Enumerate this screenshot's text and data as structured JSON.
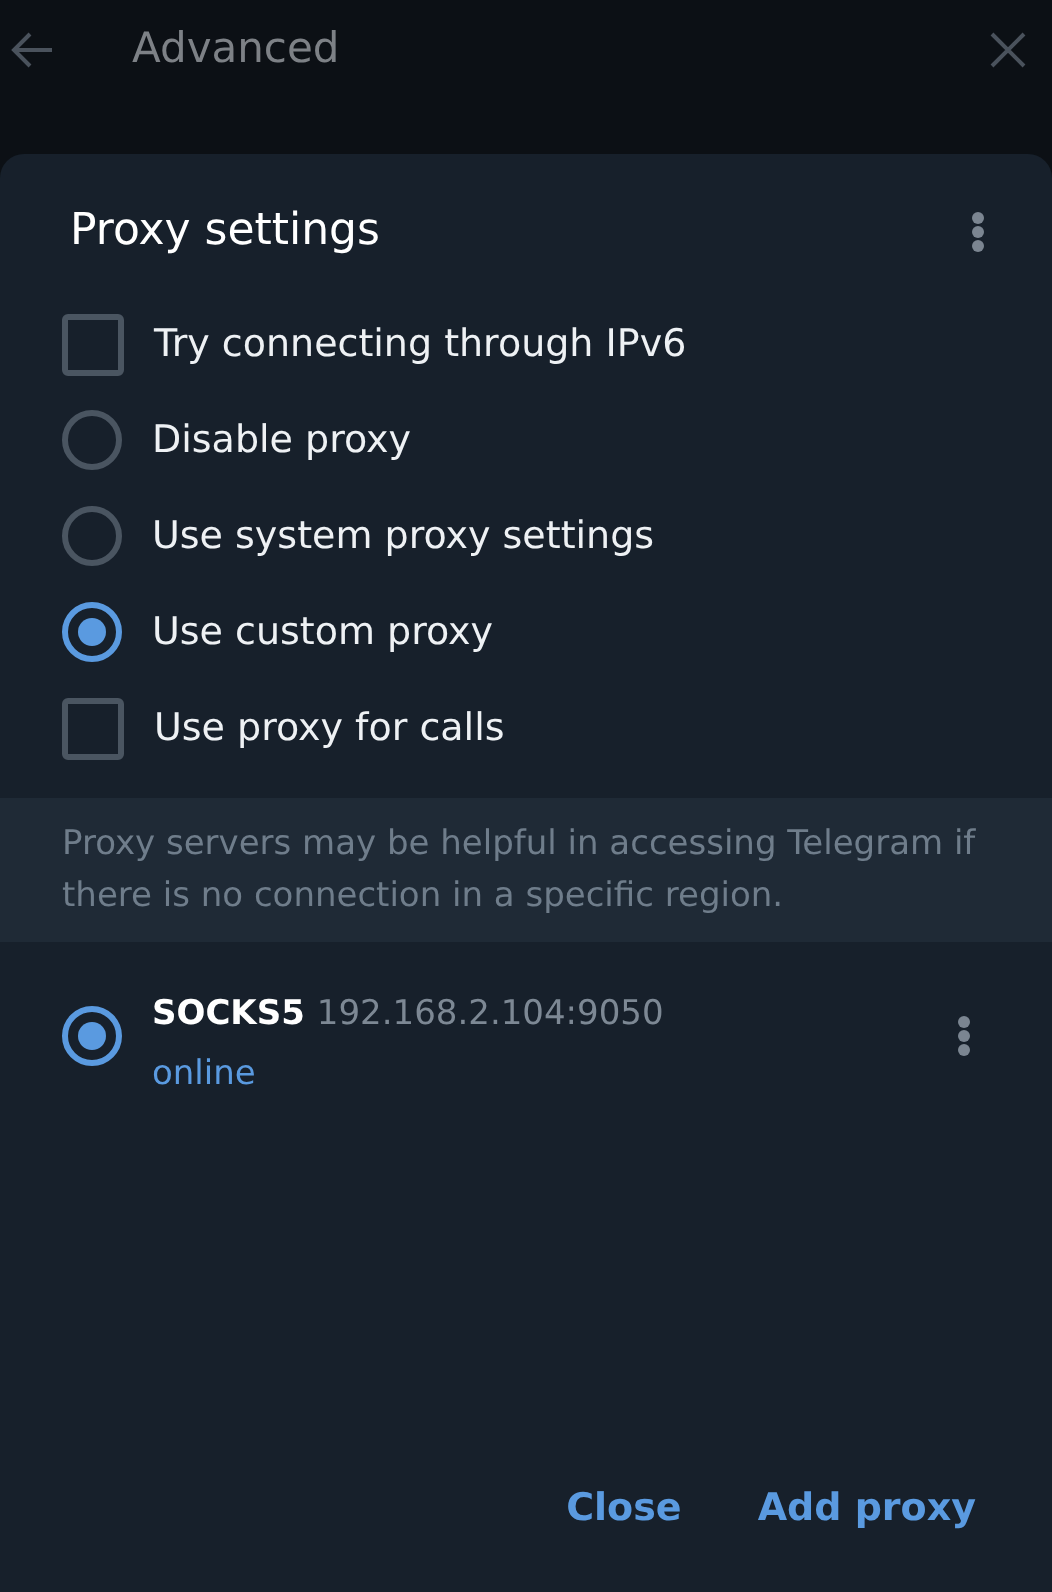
{
  "header": {
    "title": "Advanced"
  },
  "dialog": {
    "title": "Proxy settings",
    "options": [
      {
        "kind": "checkbox",
        "label": "Try connecting through IPv6",
        "checked": false
      },
      {
        "kind": "radio",
        "label": "Disable proxy",
        "selected": false
      },
      {
        "kind": "radio",
        "label": "Use system proxy settings",
        "selected": false
      },
      {
        "kind": "radio",
        "label": "Use custom proxy",
        "selected": true
      },
      {
        "kind": "checkbox",
        "label": "Use proxy for calls",
        "checked": false
      }
    ],
    "info": "Proxy servers may be helpful in accessing Telegram if there is no connection in a specific region.",
    "proxies": [
      {
        "type": "SOCKS5",
        "address": "192.168.2.104:9050",
        "status": "online",
        "selected": true
      }
    ],
    "buttons": [
      "Close",
      "Add proxy"
    ]
  }
}
